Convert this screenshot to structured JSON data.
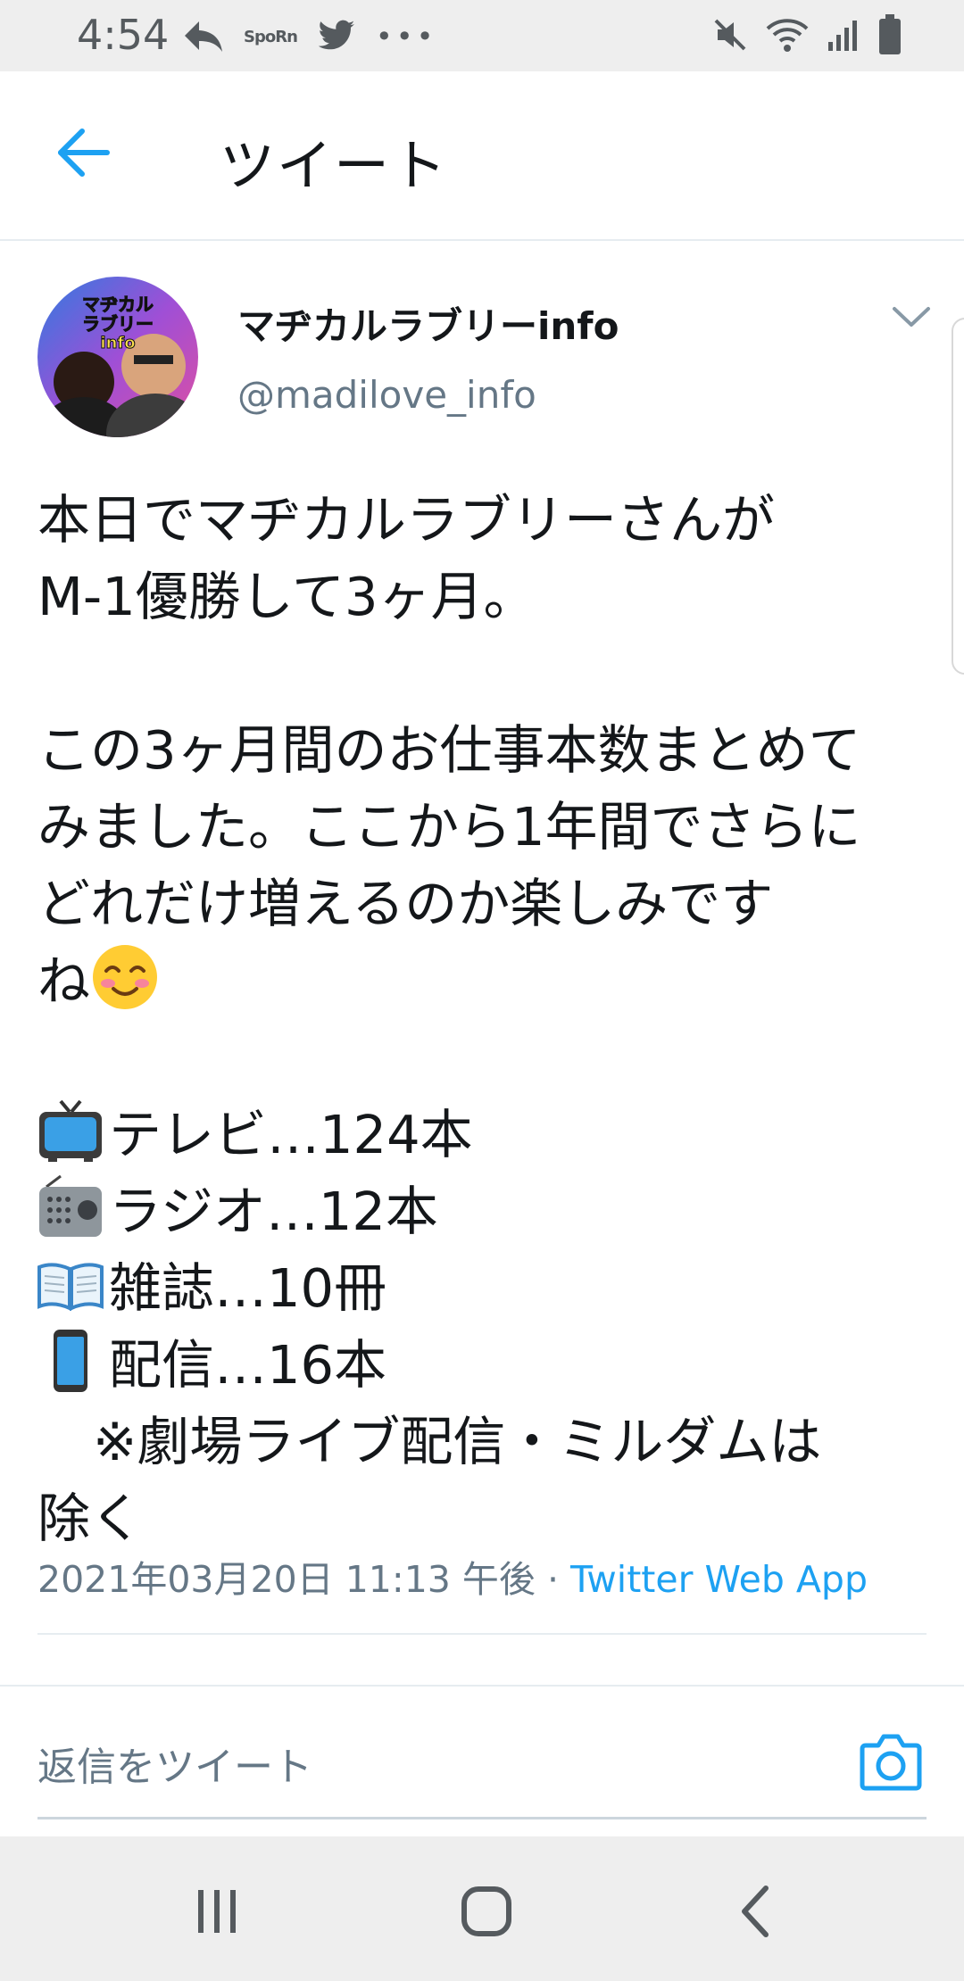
{
  "status_bar": {
    "time": "4:54",
    "left_icons": [
      "reply-arrow-icon",
      "sports-app-icon",
      "twitter-bird-icon",
      "more-dots-icon"
    ],
    "sports_icon_text": "SpoRn",
    "right_icons": [
      "mute-icon",
      "wifi-icon",
      "signal-icon",
      "battery-icon"
    ]
  },
  "header": {
    "title": "ツイート"
  },
  "tweet": {
    "author_name": "マヂカルラブリーinfo",
    "author_handle": "@madilove_info",
    "avatar_text": "マヂカル ラブリー info",
    "body": {
      "p1_line1": "本日でマヂカルラブリーさんが",
      "p1_line2": "M-1優勝して3ヶ月。",
      "p2_line1": "この3ヶ月間のお仕事本数まとめて",
      "p2_line2": "みました。ここから1年間でさらに",
      "p2_line3": "どれだけ増えるのか楽しみです",
      "p2_line4": "ね",
      "list": [
        {
          "icon": "television-icon",
          "text": "テレビ…124本"
        },
        {
          "icon": "radio-icon",
          "text": "ラジオ…12本"
        },
        {
          "icon": "open-book-icon",
          "text": "雑誌…10冊"
        },
        {
          "icon": "mobile-phone-icon",
          "text": "配信…16本"
        }
      ],
      "note_line1": "※劇場ライブ配信・ミルダムは",
      "note_line2": "除く"
    },
    "timestamp": "2021年03月20日 11:13 午後",
    "separator": " · ",
    "source": "Twitter Web App"
  },
  "reply": {
    "placeholder": "返信をツイート"
  },
  "colors": {
    "accent": "#1da1f2",
    "secondary_text": "#657786",
    "primary_text": "#14171a",
    "divider": "#e6ecf0"
  }
}
